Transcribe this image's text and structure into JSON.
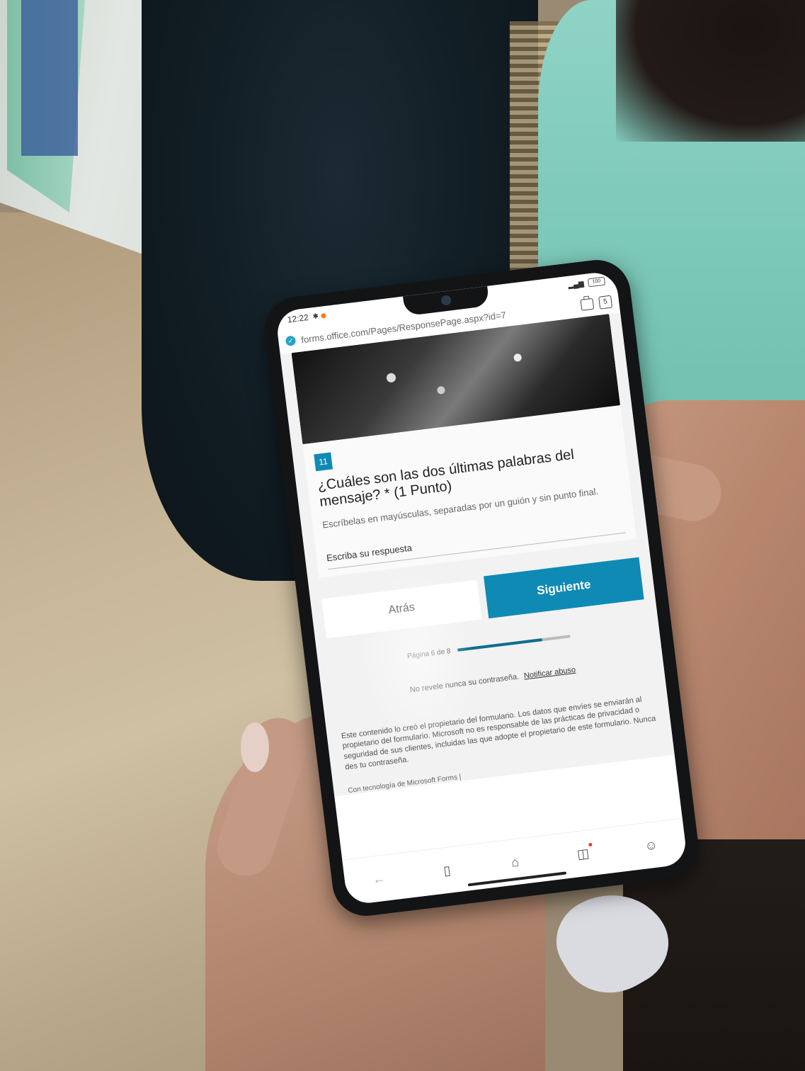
{
  "status": {
    "time": "12:22",
    "battery": "100"
  },
  "browser": {
    "url": "forms.office.com/Pages/ResponsePage.aspx?id=7",
    "tab_count": "5"
  },
  "question": {
    "number": "11",
    "title": "¿Cuáles son las dos últimas palabras del mensaje? * (1 Punto)",
    "subtitle": "Escríbelas en mayúsculas, separadas por un guión y sin punto final.",
    "answer_placeholder": "Escriba su respuesta"
  },
  "buttons": {
    "back": "Atrás",
    "next": "Siguiente"
  },
  "progress": {
    "label": "Página 6 de 8",
    "fraction": 0.75
  },
  "footer": {
    "password_warning": "No revele nunca su contraseña.",
    "report_link": "Notificar abuso",
    "disclaimer": "Este contenido lo creó el propietario del formulario. Los datos que envíes se enviarán al propietario del formulario. Microsoft no es responsable de las prácticas de privacidad o seguridad de sus clientes, incluidas las que adopte el propietario de este formulario. Nunca des tu contraseña.",
    "powered_by": "Con tecnología de Microsoft Forms |"
  },
  "colors": {
    "accent": "#0f8ab5",
    "progress": "#0f6e8f"
  },
  "nav_icons": [
    "back-arrow-icon",
    "book-icon",
    "home-icon",
    "game-icon",
    "profile-icon"
  ]
}
